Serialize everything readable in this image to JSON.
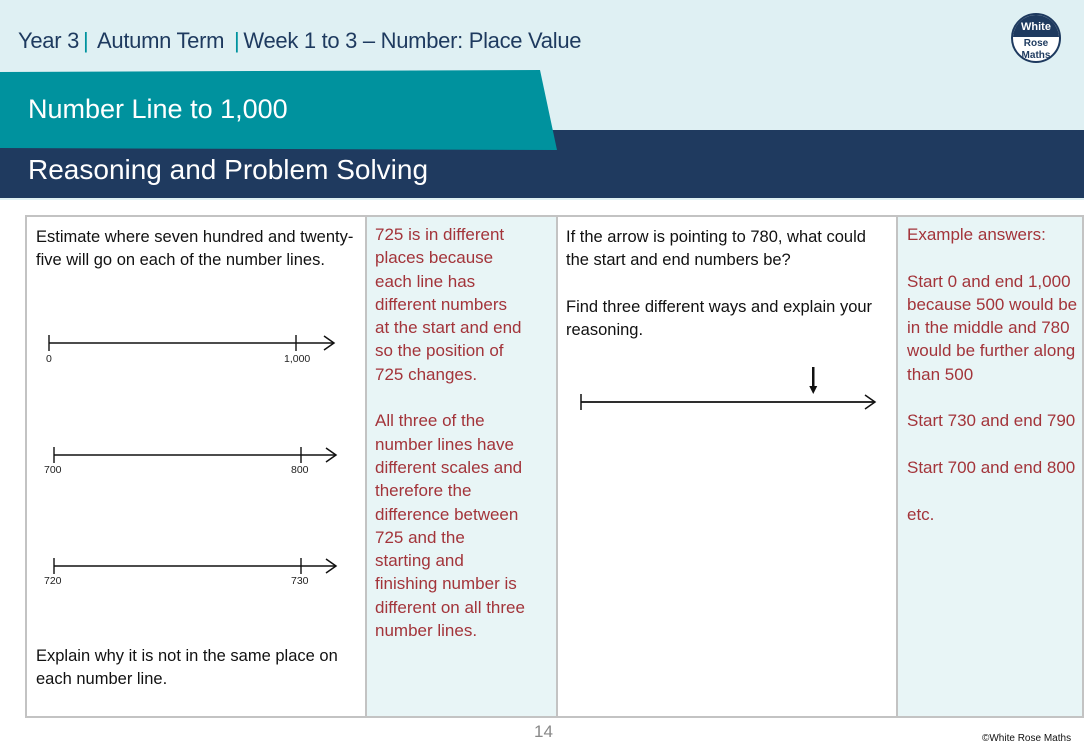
{
  "header": {
    "year": "Year 3",
    "term": "Autumn Term",
    "unit": "Week 1 to 3 – Number: Place Value",
    "separator": "|",
    "logo": {
      "line1": "White",
      "line2": "Rose",
      "line3": "Maths"
    }
  },
  "lesson_title": "Number Line to 1,000",
  "section_title": "Reasoning and Problem Solving",
  "left_panel": {
    "question_intro": "Estimate where seven hundred and twenty-five will go on each of the number lines.",
    "number_lines": [
      {
        "start": "0",
        "end": "1,000"
      },
      {
        "start": "700",
        "end": "800"
      },
      {
        "start": "720",
        "end": "730"
      }
    ],
    "question_follow": "Explain why it is not in the same place on each number line.",
    "answer_paragraphs": [
      "725 is in different places because each line has different numbers at the start and end so the position of 725 changes.",
      "All three of the number lines have different scales and therefore the difference between 725 and the starting and finishing number is different on all three number lines."
    ]
  },
  "right_panel": {
    "question_paragraphs": [
      "If the arrow is pointing to 780, what could the start and end numbers be?",
      "Find three different ways and explain your reasoning."
    ],
    "arrow_target": 780,
    "arrow_position_fraction": 0.79,
    "answer_paragraphs": [
      "Example answers:",
      "Start 0 and end 1,000 because 500 would be in the middle and 780 would be further along than 500",
      "Start 730 and end 790",
      "Start 700 and end 800",
      "etc."
    ]
  },
  "footer": {
    "page_number": "14",
    "copyright": "©White Rose Maths"
  },
  "colors": {
    "teal": "#00929e",
    "navy": "#1f3a5f",
    "header_bg": "#dff0f3",
    "answer_bg": "#e8f5f6",
    "answer_text": "#a3343a"
  }
}
